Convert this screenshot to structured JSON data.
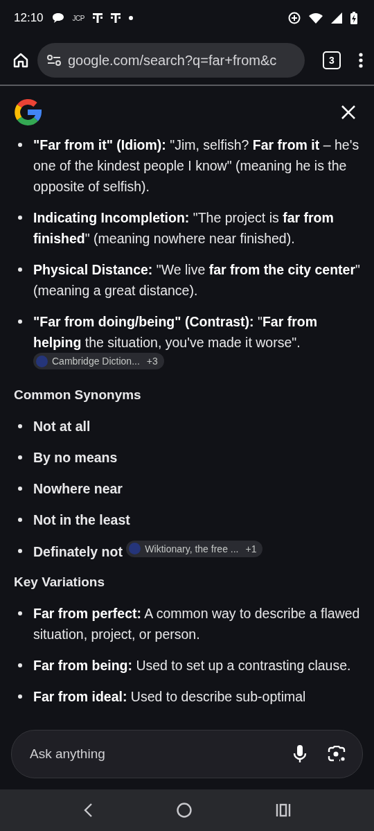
{
  "status_bar": {
    "time": "12:10",
    "notification_text": "JCP"
  },
  "browser": {
    "url": "google.com/search?q=far+from&c",
    "tab_count": "3"
  },
  "answer": {
    "blocks": [
      {
        "kind": "bullets",
        "items": [
          {
            "text": "**\"Far from it\" (Idiom):** \"Jim, selfish? **Far from it** – he's one of the kindest people I know\" (meaning he is the opposite of selfish)."
          },
          {
            "text": "**Indicating Incompletion:** \"The project is **far from finished**\" (meaning nowhere near finished)."
          },
          {
            "text": "**Physical Distance:** \"We live **far from the city center**\" (meaning a great distance)."
          },
          {
            "text": "**\"Far from doing/being\" (Contrast):** \"**Far from helping** the situation, you've made it worse\".",
            "source": {
              "label": "Cambridge Diction...",
              "extra": "+3"
            }
          }
        ]
      },
      {
        "kind": "heading",
        "text": "Common Synonyms"
      },
      {
        "kind": "terms",
        "items": [
          {
            "text": "Not at all"
          },
          {
            "text": "By no means"
          },
          {
            "text": "Nowhere near"
          },
          {
            "text": "Not in the least"
          },
          {
            "text": "Definately not",
            "source": {
              "label": "Wiktionary, the free ...",
              "extra": "+1"
            }
          }
        ]
      },
      {
        "kind": "heading",
        "text": "Key Variations"
      },
      {
        "kind": "bullets",
        "items": [
          {
            "text": "**Far from perfect:** A common way to describe a flawed situation, project, or person."
          },
          {
            "text": "**Far from being:** Used to set up a contrasting clause."
          },
          {
            "text": "**Far from ideal:** Used to describe sub-optimal"
          }
        ]
      }
    ]
  },
  "ask_bar": {
    "placeholder": "Ask anything"
  }
}
